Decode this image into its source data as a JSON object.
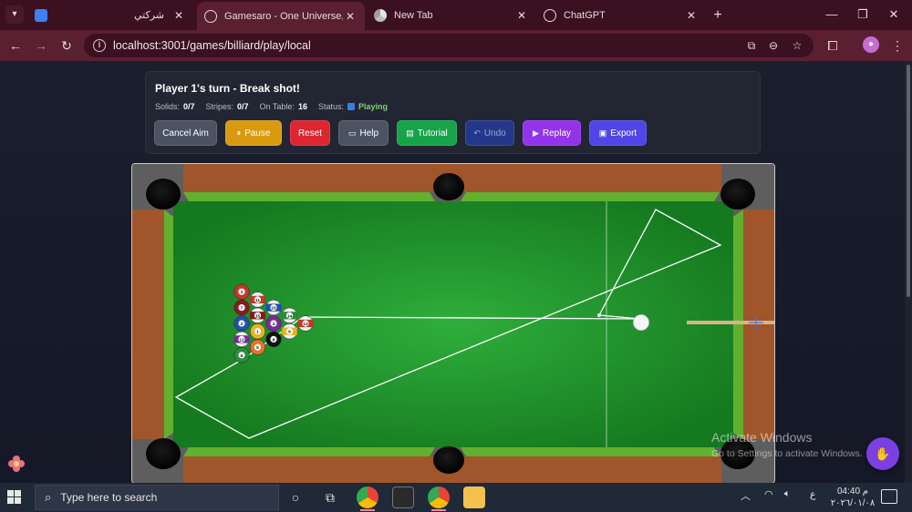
{
  "browser": {
    "tabs": [
      {
        "title": "شركتي",
        "active": false
      },
      {
        "title": "Gamesaro - One Universe, Mult",
        "active": true
      },
      {
        "title": "New Tab",
        "active": false
      },
      {
        "title": "ChatGPT",
        "active": false
      }
    ],
    "url": "localhost:3001/games/billiard/play/local"
  },
  "game": {
    "turn_text": "Player 1's turn - Break shot!",
    "solids_label": "Solids:",
    "solids_value": "0/7",
    "stripes_label": "Stripes:",
    "stripes_value": "0/7",
    "on_table_label": "On Table:",
    "on_table_value": "16",
    "status_label": "Status:",
    "status_value": "Playing",
    "buttons": {
      "cancel_aim": "Cancel Aim",
      "pause": "Pause",
      "reset": "Reset",
      "help": "Help",
      "tutorial": "Tutorial",
      "undo": "Undo",
      "replay": "Replay",
      "export": "Export"
    },
    "balls": [
      {
        "n": "13",
        "color": "#c0392b",
        "striped": true
      },
      {
        "n": "14",
        "color": "#2e8b3a",
        "striped": true
      },
      {
        "n": "9",
        "color": "#e6b422",
        "striped": true
      },
      {
        "n": "10",
        "color": "#1f4fb0",
        "striped": true
      },
      {
        "n": "4",
        "color": "#7a2a9a",
        "striped": false
      },
      {
        "n": "8",
        "color": "#111111",
        "striped": false
      },
      {
        "n": "11",
        "color": "#c0392b",
        "striped": true
      },
      {
        "n": "15",
        "color": "#8b1a1a",
        "striped": true
      },
      {
        "n": "1",
        "color": "#e6b422",
        "striped": false
      },
      {
        "n": "5",
        "color": "#e8702a",
        "striped": false
      },
      {
        "n": "3",
        "color": "#c0392b",
        "striped": false
      },
      {
        "n": "7",
        "color": "#8b1a1a",
        "striped": false
      },
      {
        "n": "2",
        "color": "#1f4fb0",
        "striped": false
      },
      {
        "n": "12",
        "color": "#7a2a9a",
        "striped": true
      },
      {
        "n": "6",
        "color": "#2e8b3a",
        "striped": false
      }
    ]
  },
  "overlay": {
    "activate_title": "Activate Windows",
    "activate_sub": "Go to Settings to activate Windows."
  },
  "taskbar": {
    "search_placeholder": "Type here to search",
    "lang": "ع",
    "time": "04:40 م",
    "date": "٢٠٢٦/٠١/٠٨"
  }
}
